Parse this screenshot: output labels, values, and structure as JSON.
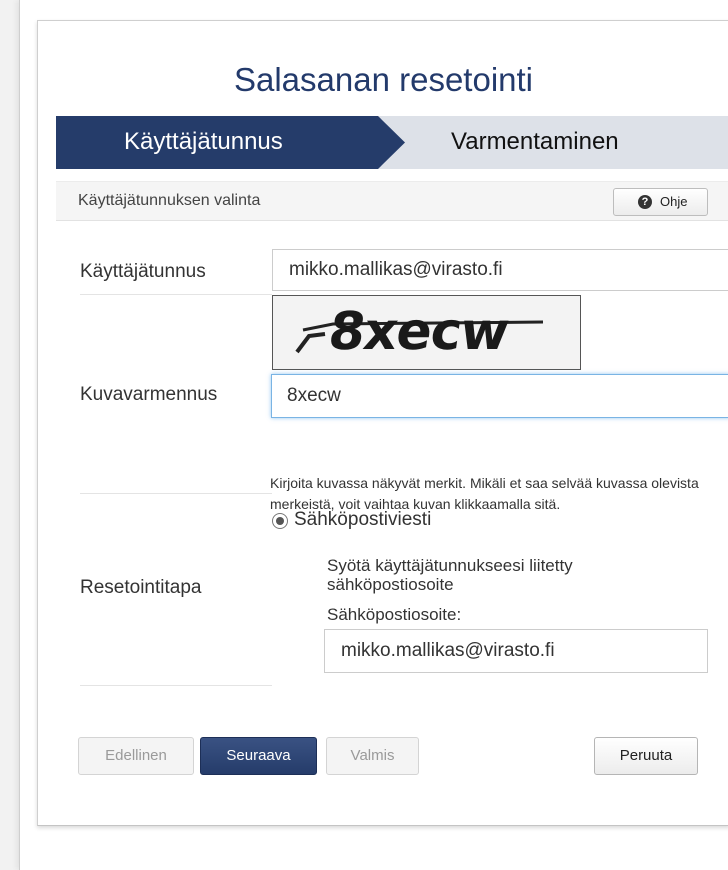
{
  "page": {
    "title": "Salasanan resetointi"
  },
  "steps": [
    {
      "label": "Käyttäjätunnus",
      "active": true
    },
    {
      "label": "Varmentaminen",
      "active": false
    }
  ],
  "section": {
    "title": "Käyttäjätunnuksen valinta",
    "help_label": "Ohje",
    "help_icon": "question-circle-icon"
  },
  "form": {
    "username": {
      "label": "Käyttäjätunnus",
      "value": "mikko.mallikas@virasto.fi"
    },
    "captcha": {
      "label": "Kuvavarmennus",
      "image_text": "8xecw",
      "value": "8xecw",
      "hint": "Kirjoita kuvassa näkyvät merkit. Mikäli et saa selvää kuvassa olevista merkeistä, voit vaihtaa kuvan klikkaamalla sitä."
    },
    "reset_method": {
      "label": "Resetointitapa",
      "option_label": "Sähköpostiviesti",
      "selected": true,
      "description": "Syötä käyttäjätunnukseesi liitetty sähköpostiosoite",
      "email_label": "Sähköpostiosoite:",
      "email_value": "mikko.mallikas@virasto.fi"
    }
  },
  "buttons": {
    "previous": "Edellinen",
    "next": "Seuraava",
    "finish": "Valmis",
    "cancel": "Peruuta"
  },
  "colors": {
    "accent": "#253c6a",
    "step_active": "#253c6a",
    "step_inactive": "#dde1e8",
    "focus": "#7ab4e4"
  }
}
